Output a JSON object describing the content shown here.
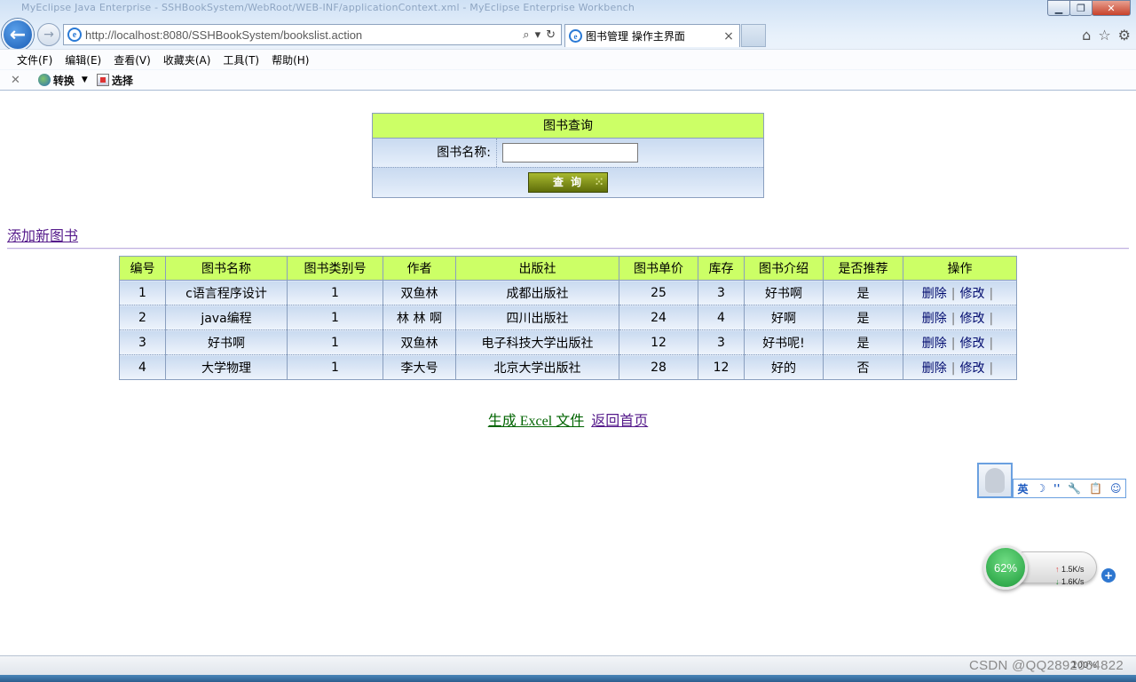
{
  "browser": {
    "window_title": "MyEclipse Java Enterprise - SSHBookSystem/WebRoot/WEB-INF/applicationContext.xml - MyEclipse Enterprise Workbench",
    "address": "http://localhost:8080/SSHBookSystem/bookslist.action",
    "tab_label": "图书管理 操作主界面",
    "menu": [
      "文件(F)",
      "编辑(E)",
      "查看(V)",
      "收藏夹(A)",
      "工具(T)",
      "帮助(H)"
    ],
    "toolbar": {
      "convert_label": "转换",
      "select_label": "选择"
    }
  },
  "search": {
    "title": "图书查询",
    "name_label": "图书名称:",
    "name_value": "",
    "submit_label": "查询"
  },
  "add_link": "添加新图书",
  "table": {
    "headers": [
      "编号",
      "图书名称",
      "图书类别号",
      "作者",
      "出版社",
      "图书单价",
      "库存",
      "图书介绍",
      "是否推荐",
      "操作"
    ],
    "rows": [
      [
        "1",
        "c语言程序设计",
        "1",
        "双鱼林",
        "成都出版社",
        "25",
        "3",
        "好书啊",
        "是"
      ],
      [
        "2",
        "java编程",
        "1",
        "林 林 啊",
        "四川出版社",
        "24",
        "4",
        "好啊",
        "是"
      ],
      [
        "3",
        "好书啊",
        "1",
        "双鱼林",
        "电子科技大学出版社",
        "12",
        "3",
        "好书呢!",
        "是"
      ],
      [
        "4",
        "大学物理",
        "1",
        "李大号",
        "北京大学出版社",
        "28",
        "12",
        "好的",
        "否"
      ]
    ],
    "delete_label": "删除",
    "edit_label": "修改",
    "separator": "|"
  },
  "bottom": {
    "excel_link": "生成 Excel 文件",
    "home_link": "返回首页"
  },
  "ime": {
    "items": [
      "英",
      "☽",
      "''",
      "🔧",
      "📋",
      "☺"
    ]
  },
  "net_meter": {
    "percent": "62%",
    "up": "1.5K/s",
    "down": "1.6K/s"
  },
  "status": {
    "watermark": "CSDN @QQ2892064822",
    "zoom": "100%"
  }
}
